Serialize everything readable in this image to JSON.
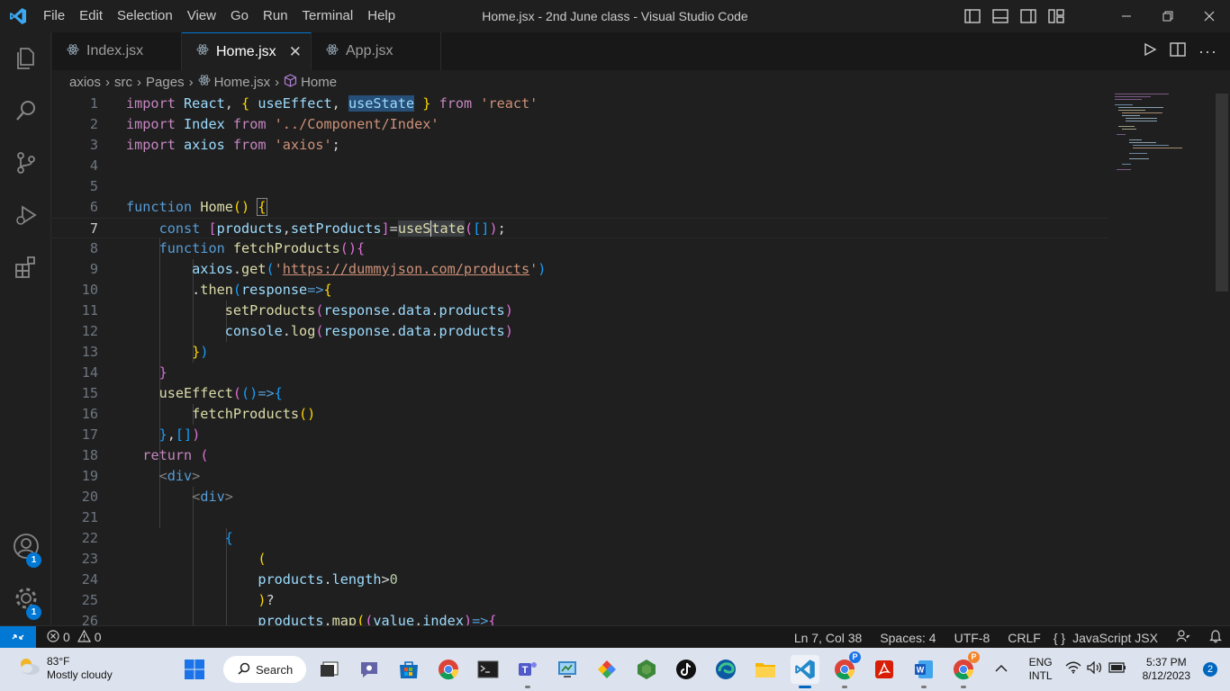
{
  "window": {
    "title": "Home.jsx - 2nd June class - Visual Studio Code",
    "menu": [
      "File",
      "Edit",
      "Selection",
      "View",
      "Go",
      "Run",
      "Terminal",
      "Help"
    ]
  },
  "tabs": [
    {
      "label": "Index.jsx",
      "active": false
    },
    {
      "label": "Home.jsx",
      "active": true
    },
    {
      "label": "App.jsx",
      "active": false
    }
  ],
  "breadcrumb": [
    "axios",
    "src",
    "Pages",
    "Home.jsx",
    "Home"
  ],
  "activity": {
    "accounts_badge": "1",
    "settings_badge": "1"
  },
  "editor": {
    "line_numbers": [
      "1",
      "2",
      "3",
      "4",
      "5",
      "6",
      "7",
      "8",
      "9",
      "10",
      "11",
      "12",
      "13",
      "14",
      "15",
      "16",
      "17",
      "18",
      "19",
      "20",
      "21",
      "22",
      "23",
      "24",
      "25",
      "26"
    ],
    "current_line": 7,
    "code_lines": [
      "import React, { useEffect, useState } from 'react'",
      "import Index from '../Component/Index'",
      "import axios from 'axios';",
      "",
      "",
      "function Home() {",
      "    const [products,setProducts]=useState([]);",
      "    function fetchProducts(){",
      "        axios.get('https://dummyjson.com/products')",
      "        .then(response=>{",
      "            setProducts(response.data.products)",
      "            console.log(response.data.products)",
      "        })",
      "    }",
      "    useEffect(()=>{",
      "        fetchProducts()",
      "    },[])",
      "  return (",
      "    <div>",
      "        <div>",
      "",
      "            {",
      "                (",
      "                products.length>0",
      "                )?",
      "                products.map((value,index)=>{"
    ]
  },
  "statusbar": {
    "errors": "0",
    "warnings": "0",
    "position": "Ln 7, Col 38",
    "spaces": "Spaces: 4",
    "encoding": "UTF-8",
    "eol": "CRLF",
    "language": "JavaScript JSX"
  },
  "taskbar": {
    "weather_temp": "83°F",
    "weather_desc": "Mostly cloudy",
    "search_label": "Search",
    "lang_top": "ENG",
    "lang_bottom": "INTL",
    "time": "5:37 PM",
    "date": "8/12/2023",
    "notification_count": "2"
  },
  "colors": {
    "accent": "#0078d4",
    "keyword": "#c586c0",
    "function": "#dcdcaa",
    "variable": "#9cdcfe",
    "string": "#ce9178"
  }
}
